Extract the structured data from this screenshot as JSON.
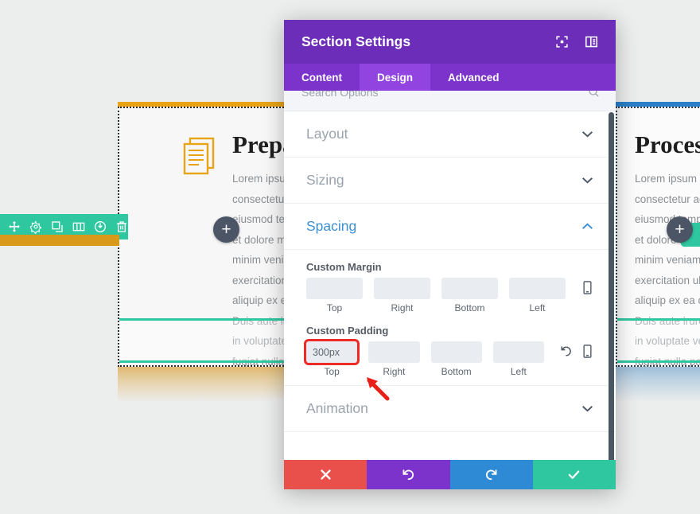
{
  "canvas": {
    "background_color": "#eceded"
  },
  "page_builder": {
    "section_toolbar": {
      "background_color": "#2ec7a0",
      "icons": [
        {
          "name": "move-icon",
          "label": "Move Section"
        },
        {
          "name": "gear-icon",
          "label": "Section Settings"
        },
        {
          "name": "duplicate-icon",
          "label": "Duplicate Section"
        },
        {
          "name": "columns-icon",
          "label": "Change Column Structure"
        },
        {
          "name": "save-icon",
          "label": "Save to Library"
        },
        {
          "name": "trash-icon",
          "label": "Delete Section"
        }
      ]
    },
    "add_row_button_label": "+",
    "cards": [
      {
        "side": "left",
        "accent_color": "#e8a317",
        "heading": "Prepa",
        "body_lines": [
          "Lorem ipsum",
          "consectetur a",
          "eiusmod tem",
          "et dolore mag",
          "minim veniam",
          "exercitation u",
          "aliquip ex ea",
          "Duis aute irur",
          "in voluptate v",
          "fugiat nulla pa"
        ]
      },
      {
        "side": "right",
        "accent_color": "#2a7fc9",
        "heading": "Process",
        "body_lines": [
          "Lorem ipsum dolo",
          "consectetur adipis",
          "eiusmod tempor in",
          "et dolore magna a",
          "minim veniam, qui",
          "exercitation ullamc",
          "aliquip ex ea comm",
          "Duis aute irure dol",
          "in voluptate velit e",
          "fugiat nulla pariatu"
        ]
      }
    ]
  },
  "modal": {
    "title": "Section Settings",
    "header_color": "#6c2eb9",
    "header_icons": [
      {
        "name": "expand-icon",
        "label": "Expand"
      },
      {
        "name": "panel-layout-icon",
        "label": "Change Modal Position"
      }
    ],
    "tabs": [
      {
        "label": "Content",
        "active": false
      },
      {
        "label": "Design",
        "active": true
      },
      {
        "label": "Advanced",
        "active": false
      }
    ],
    "search": {
      "placeholder": "Search Options",
      "icon": "search-icon"
    },
    "accordions": [
      {
        "label": "Layout",
        "open": false,
        "chevron": "chevron-down-icon"
      },
      {
        "label": "Sizing",
        "open": false,
        "chevron": "chevron-down-icon"
      },
      {
        "label": "Spacing",
        "open": true,
        "chevron": "chevron-up-icon"
      },
      {
        "label": "Animation",
        "open": false,
        "chevron": "chevron-down-icon"
      }
    ],
    "spacing": {
      "custom_margin": {
        "label": "Custom Margin",
        "fields": [
          {
            "caption": "Top",
            "value": "",
            "highlighted": false
          },
          {
            "caption": "Right",
            "value": "",
            "highlighted": false
          },
          {
            "caption": "Bottom",
            "value": "",
            "highlighted": false
          },
          {
            "caption": "Left",
            "value": "",
            "highlighted": false
          }
        ],
        "side_icons": [
          "mobile-icon"
        ]
      },
      "custom_padding": {
        "label": "Custom Padding",
        "fields": [
          {
            "caption": "Top",
            "value": "300px",
            "highlighted": true
          },
          {
            "caption": "Right",
            "value": "",
            "highlighted": false
          },
          {
            "caption": "Bottom",
            "value": "",
            "highlighted": false
          },
          {
            "caption": "Left",
            "value": "",
            "highlighted": false
          }
        ],
        "side_icons": [
          "reset-icon",
          "mobile-icon"
        ]
      },
      "annotation": {
        "type": "arrow",
        "color": "#e8201a",
        "points_to": "custom-padding-top-field"
      }
    },
    "footer_buttons": [
      {
        "name": "cancel-button",
        "icon": "close-icon",
        "color": "#e9504c"
      },
      {
        "name": "undo-button",
        "icon": "undo-icon",
        "color": "#7b33cc"
      },
      {
        "name": "redo-button",
        "icon": "redo-icon",
        "color": "#2f8ad6"
      },
      {
        "name": "save-button",
        "icon": "check-icon",
        "color": "#2ec7a0"
      }
    ]
  }
}
